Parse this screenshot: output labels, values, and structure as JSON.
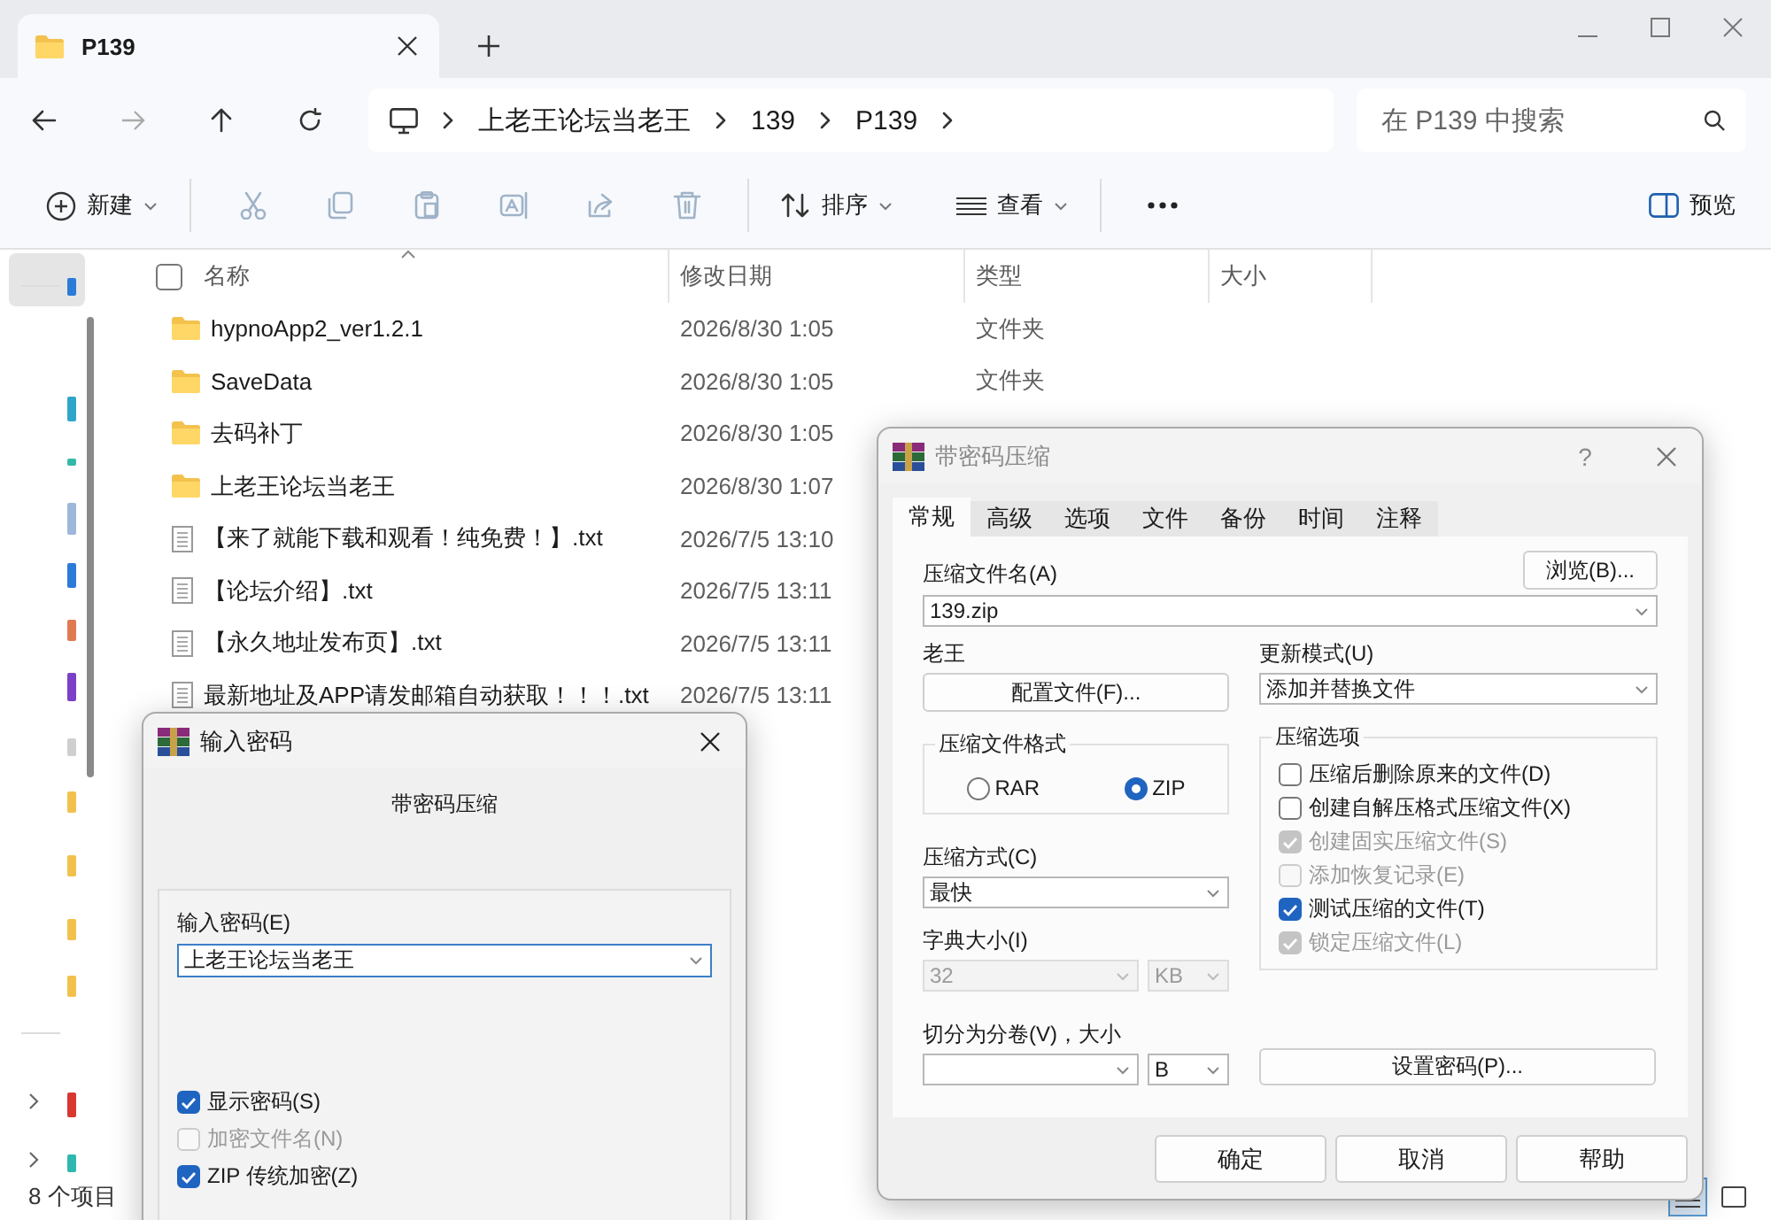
{
  "explorer": {
    "tab": {
      "title": "P139"
    },
    "breadcrumb": [
      "上老王论坛当老王",
      "139",
      "P139"
    ],
    "search": {
      "placeholder": "在 P139 中搜索"
    },
    "toolbar": {
      "new": "新建",
      "sort": "排序",
      "view": "查看",
      "preview": "预览"
    },
    "select_all": {
      "checked": false
    },
    "columns": [
      "名称",
      "修改日期",
      "类型",
      "大小"
    ],
    "rows": [
      {
        "kind": "folder",
        "name": "hypnoApp2_ver1.2.1",
        "modified": "2026/8/30 1:05",
        "type": "文件夹"
      },
      {
        "kind": "folder",
        "name": "SaveData",
        "modified": "2026/8/30 1:05",
        "type": "文件夹"
      },
      {
        "kind": "folder",
        "name": "去码补丁",
        "modified": "2026/8/30 1:05"
      },
      {
        "kind": "folder",
        "name": "上老王论坛当老王",
        "modified": "2026/8/30 1:07"
      },
      {
        "kind": "text",
        "name": "【来了就能下载和观看！纯免费！】.txt",
        "modified": "2026/7/5 13:10"
      },
      {
        "kind": "text",
        "name": "【论坛介绍】.txt",
        "modified": "2026/7/5 13:11"
      },
      {
        "kind": "text",
        "name": "【永久地址发布页】.txt",
        "modified": "2026/7/5 13:11"
      },
      {
        "kind": "text",
        "name": "最新地址及APP请发邮箱自动获取！！！.txt",
        "modified": "2026/7/5 13:11"
      }
    ],
    "status_bar": "8 个项目"
  },
  "archive_dialog": {
    "title": "带密码压缩",
    "help": "?",
    "tabs": [
      {
        "label": "常规",
        "selected": true
      },
      {
        "label": "高级",
        "selected": false
      },
      {
        "label": "选项",
        "selected": false
      },
      {
        "label": "文件",
        "selected": false
      },
      {
        "label": "备份",
        "selected": false
      },
      {
        "label": "时间",
        "selected": false
      },
      {
        "label": "注释",
        "selected": false
      }
    ],
    "archive_name_label": "压缩文件名(A)",
    "browse_button": "浏览(B)...",
    "archive_name": "139.zip",
    "profile_label": "老王",
    "profile_button": "配置文件(F)...",
    "update_mode_label": "更新模式(U)",
    "update_mode": "添加并替换文件",
    "format": {
      "title": "压缩文件格式",
      "options": [
        {
          "label": "RAR",
          "selected": false
        },
        {
          "label": "ZIP",
          "selected": true
        }
      ]
    },
    "method_label": "压缩方式(C)",
    "method": "最快",
    "dictionary": {
      "label": "字典大小(I)",
      "value": "32",
      "unit": "KB",
      "disabled": true
    },
    "split": {
      "label": "切分为分卷(V)，大小",
      "unit": "B"
    },
    "options": {
      "title": "压缩选项",
      "items": [
        {
          "label": "压缩后删除原来的文件(D)",
          "checked": false,
          "disabled": false
        },
        {
          "label": "创建自解压格式压缩文件(X)",
          "checked": false,
          "disabled": false
        },
        {
          "label": "创建固实压缩文件(S)",
          "checked": true,
          "disabled": true
        },
        {
          "label": "添加恢复记录(E)",
          "checked": false,
          "disabled": true
        },
        {
          "label": "测试压缩的文件(T)",
          "checked": true,
          "disabled": false
        },
        {
          "label": "锁定压缩文件(L)",
          "checked": true,
          "disabled": true
        }
      ]
    },
    "set_password_button": "设置密码(P)...",
    "buttons": [
      "确定",
      "取消",
      "帮助"
    ]
  },
  "password_dialog": {
    "title": "输入密码",
    "subtitle": "带密码压缩",
    "field_label": "输入密码(E)",
    "value": "上老王论坛当老王",
    "checkboxes": [
      {
        "label": "显示密码(S)",
        "checked": true,
        "disabled": false
      },
      {
        "label": "加密文件名(N)",
        "checked": false,
        "disabled": true
      },
      {
        "label": "ZIP 传统加密(Z)",
        "checked": true,
        "disabled": false
      }
    ]
  }
}
